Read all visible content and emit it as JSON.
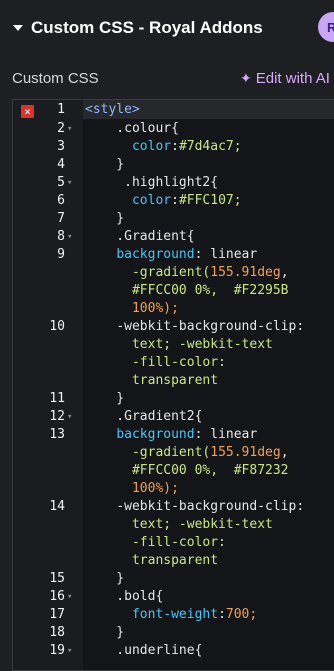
{
  "header": {
    "title": "Custom CSS - Royal Addons",
    "avatar_letter": "R"
  },
  "section": {
    "label": "Custom CSS",
    "edit_ai": "Edit with AI"
  },
  "editor": {
    "lines": [
      {
        "n": "1",
        "fold": false,
        "error": true
      },
      {
        "n": "2",
        "fold": true
      },
      {
        "n": "3",
        "fold": false
      },
      {
        "n": "4",
        "fold": false
      },
      {
        "n": "5",
        "fold": true
      },
      {
        "n": "6",
        "fold": false
      },
      {
        "n": "7",
        "fold": false
      },
      {
        "n": "8",
        "fold": true
      },
      {
        "n": "9",
        "fold": false
      },
      {
        "n": "10",
        "fold": false
      },
      {
        "n": "11",
        "fold": false
      },
      {
        "n": "12",
        "fold": true
      },
      {
        "n": "13",
        "fold": false
      },
      {
        "n": "14",
        "fold": false
      },
      {
        "n": "15",
        "fold": false
      },
      {
        "n": "16",
        "fold": true
      },
      {
        "n": "17",
        "fold": false
      },
      {
        "n": "18",
        "fold": false
      },
      {
        "n": "19",
        "fold": true
      }
    ],
    "code": {
      "l1": "<style>",
      "l2": "    .colour{",
      "l3_prop": "color",
      "l3_val": "#7d4ac7;",
      "l4": "    }",
      "l5": "     .highlight2{",
      "l6_prop": "color",
      "l6_val": "#FFC107;",
      "l7": "    }",
      "l8": "    .Gradient{",
      "l9_prop": "background",
      "l9_a": "linear",
      "l9_b": "-gradient(",
      "l9_c": "155.91deg",
      "l9_d": ",",
      "l9_e": "#FFCC00 0%,",
      "l9_f": "#F2295B",
      "l9_g": "100%);",
      "l10_a": "-webkit-background-clip:",
      "l10_b": "text; -webkit-text",
      "l10_c": "-fill-color:",
      "l10_d": "transparent",
      "l11": "    }",
      "l12": "    .Gradient2{",
      "l13_prop": "background",
      "l13_a": "linear",
      "l13_b": "-gradient(",
      "l13_c": "155.91deg",
      "l13_d": ",",
      "l13_e": "#FFCC00 0%,",
      "l13_f": "#F87232",
      "l13_g": "100%);",
      "l14_a": "-webkit-background-clip:",
      "l14_b": "text; -webkit-text",
      "l14_c": "-fill-color:",
      "l14_d": "transparent",
      "l15": "    }",
      "l16": "    .bold{",
      "l17_prop": "font-weight",
      "l17_val": "700;",
      "l18": "    }",
      "l19": "    .underline{"
    },
    "error_icon": "error-x-icon",
    "fold_icon": "chevron-down-icon"
  },
  "colors": {
    "background": "#1d1f23",
    "property": "#4fc3f7",
    "value": "#c8e68a",
    "number": "#f2a05a",
    "error": "#d9342b",
    "ai_accent": "#d9a8ff"
  }
}
